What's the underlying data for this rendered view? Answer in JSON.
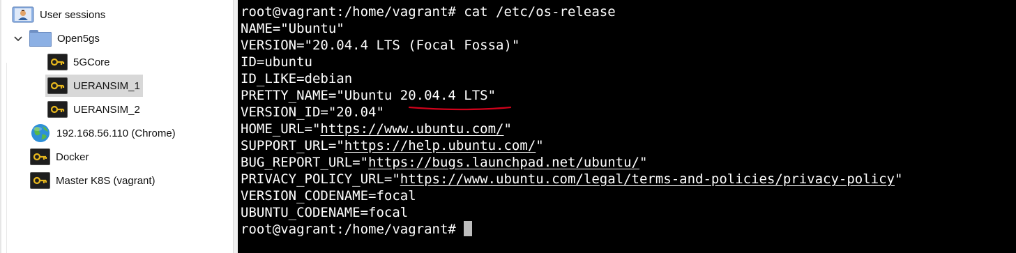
{
  "sidebar": {
    "items": [
      {
        "label": "User sessions",
        "icon": "user-sessions-icon"
      },
      {
        "label": "Open5gs",
        "icon": "folder-icon",
        "expanded": true
      },
      {
        "label": "5GCore",
        "icon": "key-icon"
      },
      {
        "label": "UERANSIM_1",
        "icon": "key-icon",
        "selected": true
      },
      {
        "label": "UERANSIM_2",
        "icon": "key-icon"
      },
      {
        "label": "192.168.56.110 (Chrome)",
        "icon": "globe-icon"
      },
      {
        "label": "Docker",
        "icon": "key-icon"
      },
      {
        "label": "Master K8S (vagrant)",
        "icon": "key-icon"
      }
    ]
  },
  "terminal": {
    "lines": [
      {
        "pre": "root@vagrant:/home/vagrant# cat /etc/os-release"
      },
      {
        "pre": "NAME=\"Ubuntu\""
      },
      {
        "pre": "VERSION=\"20.04.4 LTS (Focal Fossa)\""
      },
      {
        "pre": "ID=ubuntu"
      },
      {
        "pre": "ID_LIKE=debian"
      },
      {
        "pre": "PRETTY_NAME=\"Ubuntu 20.04.4 LTS\""
      },
      {
        "pre": "VERSION_ID=\"20.04\""
      },
      {
        "pre": "HOME_URL=\"",
        "link": "https://www.ubuntu.com/",
        "post": "\""
      },
      {
        "pre": "SUPPORT_URL=\"",
        "link": "https://help.ubuntu.com/",
        "post": "\""
      },
      {
        "pre": "BUG_REPORT_URL=\"",
        "link": "https://bugs.launchpad.net/ubuntu/",
        "post": "\""
      },
      {
        "pre": "PRIVACY_POLICY_URL=\"",
        "link": "https://www.ubuntu.com/legal/terms-and-policies/privacy-policy",
        "post": "\""
      },
      {
        "pre": "VERSION_CODENAME=focal"
      },
      {
        "pre": "UBUNTU_CODENAME=focal"
      },
      {
        "pre": "root@vagrant:/home/vagrant# "
      }
    ],
    "annotation_color": "#d0021b",
    "cursor_color": "#bdbdbd"
  },
  "colors": {
    "terminal_bg": "#000000",
    "terminal_fg": "#ffffff",
    "selection_bg": "#d8d8d8",
    "folder": "#8cb0e4"
  }
}
